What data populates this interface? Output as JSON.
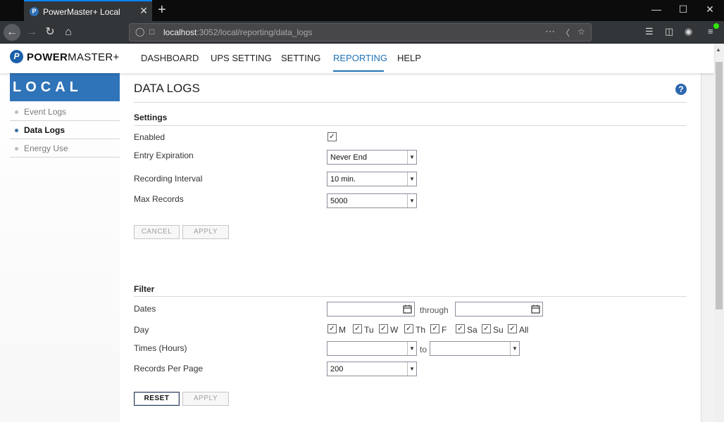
{
  "browser": {
    "tab_title": "PowerMaster+ Local",
    "tab_favicon": "P",
    "tab_close": "✕",
    "new_tab": "+",
    "url_host": "localhost",
    "url_rest": ":3052/local/reporting/data_logs",
    "icons": [
      "back-arrow-icon",
      "forward-arrow-icon",
      "reload-icon",
      "home-icon",
      "shield-icon",
      "page-icon",
      "more-icon",
      "pocket-icon",
      "star-icon",
      "library-icon",
      "sidebar-icon",
      "account-icon",
      "menu-icon"
    ]
  },
  "header": {
    "brand_mark": "P",
    "brand_bold": "POWER",
    "brand_rest": "MASTER+",
    "nav": [
      {
        "label": "DASHBOARD"
      },
      {
        "label": "UPS SETTING"
      },
      {
        "label": "SETTING"
      },
      {
        "label": "REPORTING"
      },
      {
        "label": "HELP"
      }
    ],
    "active_nav": "REPORTING",
    "accent_color": "#1f73b7"
  },
  "sidebar": {
    "title": "LOCAL",
    "items": [
      {
        "label": "Event Logs"
      },
      {
        "label": "Data Logs"
      },
      {
        "label": "Energy Use"
      }
    ],
    "active_item": "Data Logs",
    "header_color": "#2f73b8"
  },
  "main": {
    "title": "DATA LOGS",
    "help_label": "?",
    "settings": {
      "heading": "Settings",
      "enabled_label": "Enabled",
      "enabled_checked": true,
      "check_mark": "✓",
      "expiration_label": "Entry Expiration",
      "expiration_value": "Never End",
      "interval_label": "Recording Interval",
      "interval_value": "10 min.",
      "max_records_label": "Max Records",
      "max_records_value": "5000",
      "cancel_label": "CANCEL",
      "apply_label": "APPLY"
    },
    "filter": {
      "heading": "Filter",
      "dates_label": "Dates",
      "date_from": "",
      "through_label": "through",
      "date_to": "",
      "day_label": "Day",
      "days": [
        {
          "label": "M",
          "checked": true
        },
        {
          "label": "Tu",
          "checked": true
        },
        {
          "label": "W",
          "checked": true
        },
        {
          "label": "Th",
          "checked": true
        },
        {
          "label": "F",
          "checked": true
        },
        {
          "label": "Sa",
          "checked": true
        },
        {
          "label": "Su",
          "checked": true
        },
        {
          "label": "All",
          "checked": true
        }
      ],
      "times_label": "Times (Hours)",
      "time_from": "",
      "to_label": "to",
      "time_to": "",
      "records_per_page_label": "Records Per Page",
      "records_per_page_value": "200",
      "reset_label": "RESET",
      "apply_label": "APPLY"
    }
  }
}
